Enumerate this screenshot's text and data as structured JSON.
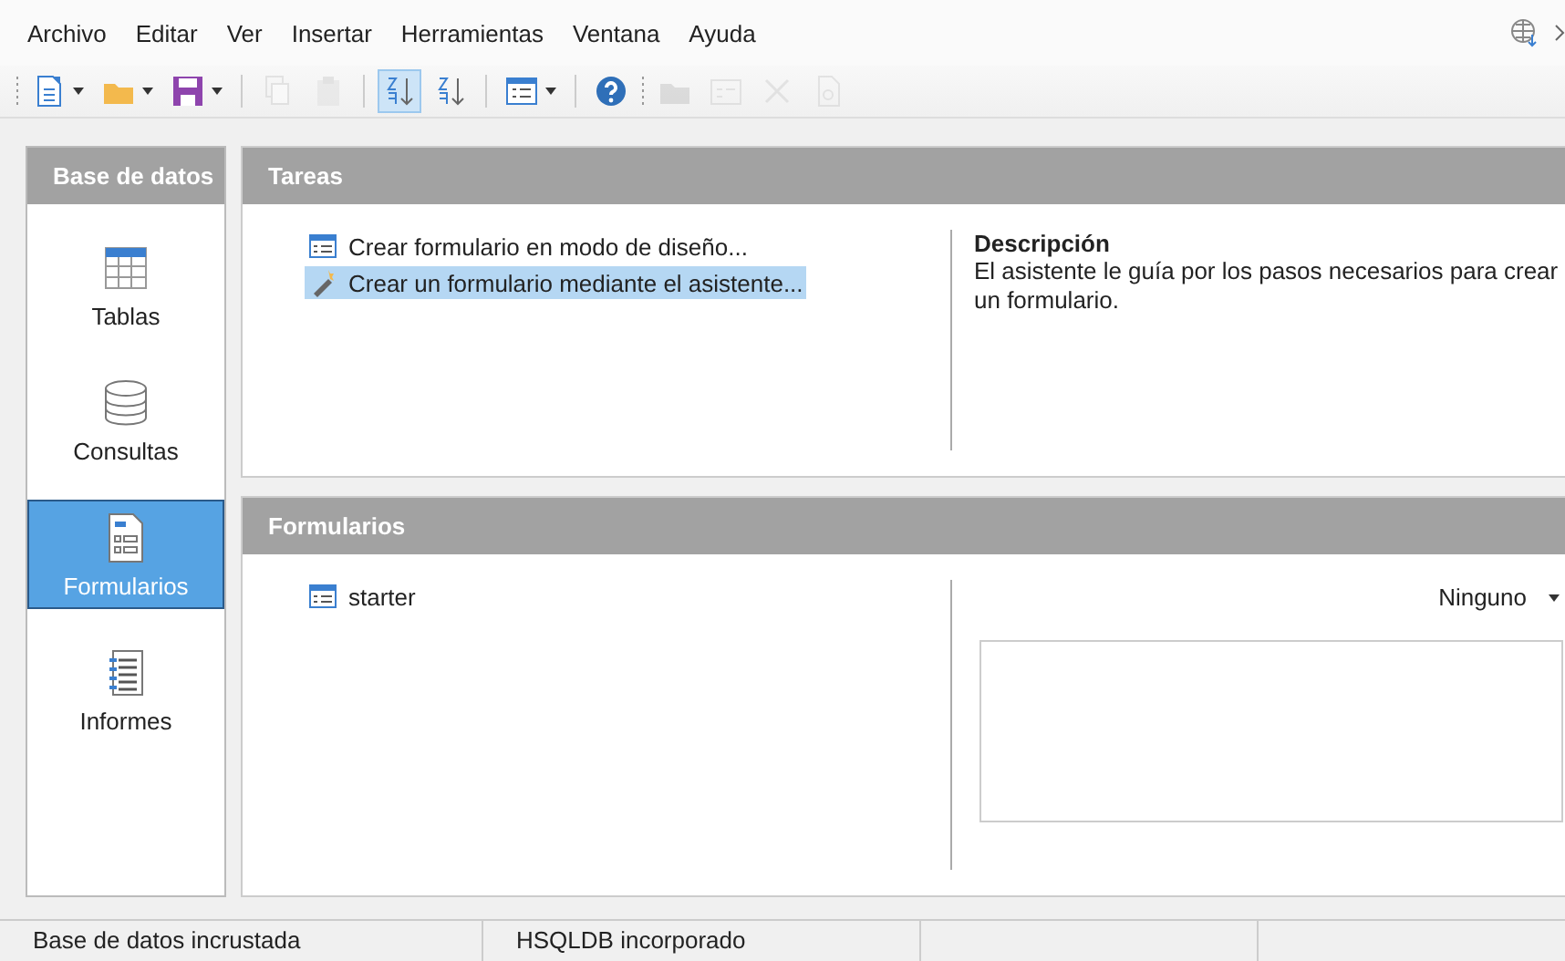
{
  "menu": [
    "Archivo",
    "Editar",
    "Ver",
    "Insertar",
    "Herramientas",
    "Ventana",
    "Ayuda"
  ],
  "toolbar": [
    {
      "kind": "new",
      "dropdown": true,
      "disabled": false,
      "selected": false
    },
    {
      "kind": "open",
      "dropdown": true,
      "disabled": false,
      "selected": false
    },
    {
      "kind": "save",
      "dropdown": true,
      "disabled": false,
      "selected": false
    },
    {
      "kind": "separator"
    },
    {
      "kind": "copy",
      "dropdown": false,
      "disabled": true,
      "selected": false
    },
    {
      "kind": "paste",
      "dropdown": false,
      "disabled": true,
      "selected": false
    },
    {
      "kind": "separator"
    },
    {
      "kind": "sort-asc",
      "dropdown": false,
      "disabled": false,
      "selected": true
    },
    {
      "kind": "sort-desc",
      "dropdown": false,
      "disabled": false,
      "selected": false
    },
    {
      "kind": "separator"
    },
    {
      "kind": "form",
      "dropdown": true,
      "disabled": false,
      "selected": false
    },
    {
      "kind": "separator"
    },
    {
      "kind": "help",
      "dropdown": false,
      "disabled": false,
      "selected": false
    },
    {
      "kind": "grip"
    },
    {
      "kind": "folder",
      "dropdown": false,
      "disabled": true,
      "selected": false
    },
    {
      "kind": "edit",
      "dropdown": false,
      "disabled": true,
      "selected": false
    },
    {
      "kind": "delete",
      "dropdown": false,
      "disabled": true,
      "selected": false
    },
    {
      "kind": "rename",
      "dropdown": false,
      "disabled": true,
      "selected": false
    }
  ],
  "sidebar": {
    "title": "Base de datos",
    "items": [
      {
        "label": "Tablas",
        "kind": "table",
        "selected": false
      },
      {
        "label": "Consultas",
        "kind": "query",
        "selected": false
      },
      {
        "label": "Formularios",
        "kind": "form",
        "selected": true
      },
      {
        "label": "Informes",
        "kind": "report",
        "selected": false
      }
    ]
  },
  "tasks": {
    "title": "Tareas",
    "items": [
      {
        "label": "Crear formulario en modo de diseño...",
        "kind": "design",
        "selected": false
      },
      {
        "label": "Crear un formulario mediante el asistente...",
        "kind": "wizard",
        "selected": true
      }
    ],
    "description_title": "Descripción",
    "description": "El asistente le guía por los pasos necesarios para crear un formulario."
  },
  "forms": {
    "title": "Formularios",
    "items": [
      {
        "label": "starter",
        "selected": false
      }
    ],
    "preview": "Ninguno"
  },
  "status_bar": [
    "Base de datos incrustada",
    "HSQLDB incorporado"
  ]
}
